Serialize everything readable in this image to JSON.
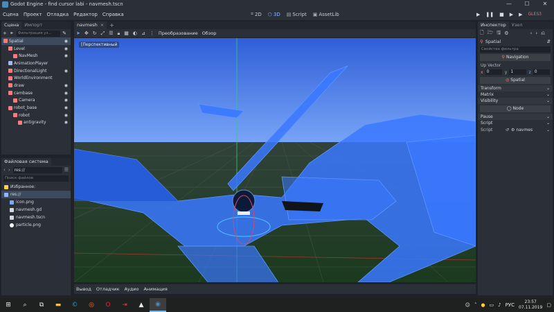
{
  "window": {
    "title": "Godot Engine - find cursor labi - navmesh.tscn",
    "controls": [
      "—",
      "☐",
      "✕"
    ]
  },
  "menu": {
    "items": [
      "Сцена",
      "Проект",
      "Отладка",
      "Редактор",
      "Справка"
    ]
  },
  "workspaces": {
    "items": [
      {
        "label": "2D",
        "icon": "grid-icon"
      },
      {
        "label": "3D",
        "icon": "cube-icon"
      },
      {
        "label": "Script",
        "icon": "script-icon"
      },
      {
        "label": "AssetLib",
        "icon": "assetlib-icon"
      }
    ],
    "active": "3D"
  },
  "playbar": {
    "buttons": [
      "▶",
      "❚❚",
      "■",
      "▶",
      "▶"
    ],
    "renderer": "GLES3"
  },
  "scene_dock": {
    "tabs": [
      "Сцена",
      "Импорт"
    ],
    "filter_placeholder": "Фильтрация уз...",
    "nodes": [
      {
        "label": "Spatial",
        "indent": 0,
        "color": "#ff7a7a",
        "eye": true,
        "selected": true
      },
      {
        "label": "Level",
        "indent": 1,
        "color": "#ff7a7a",
        "eye": true
      },
      {
        "label": "NavMesh",
        "indent": 2,
        "color": "#ff7a7a",
        "eye": true
      },
      {
        "label": "AnimationPlayer",
        "indent": 1,
        "color": "#a5b7f3",
        "eye": false
      },
      {
        "label": "DirectionalLight",
        "indent": 1,
        "color": "#ff7a7a",
        "eye": true
      },
      {
        "label": "WorldEnvironment",
        "indent": 1,
        "color": "#ff7a7a",
        "eye": false
      },
      {
        "label": "draw",
        "indent": 1,
        "color": "#ff7a7a",
        "eye": true
      },
      {
        "label": "cambase",
        "indent": 1,
        "color": "#ff7a7a",
        "eye": true
      },
      {
        "label": "Camera",
        "indent": 2,
        "color": "#ff7a7a",
        "eye": true
      },
      {
        "label": "robot_base",
        "indent": 1,
        "color": "#ff7a7a",
        "eye": true
      },
      {
        "label": "robot",
        "indent": 2,
        "color": "#ff7a7a",
        "eye": true
      },
      {
        "label": "antigravity",
        "indent": 3,
        "color": "#ff7a7a",
        "eye": true
      }
    ]
  },
  "filesystem": {
    "title": "Файловая система",
    "path": "res://",
    "search_placeholder": "Поиск файлов",
    "items": [
      {
        "label": "Избранное:",
        "icon": "star-icon",
        "indent": 0
      },
      {
        "label": "res://",
        "icon": "folder-icon",
        "indent": 0,
        "selected": true
      },
      {
        "label": "icon.png",
        "icon": "image-icon",
        "indent": 1
      },
      {
        "label": "navmesh.gd",
        "icon": "gear-icon",
        "indent": 1
      },
      {
        "label": "navmesh.tscn",
        "icon": "scene-icon",
        "indent": 1
      },
      {
        "label": "particle.png",
        "icon": "dot-icon",
        "indent": 1
      }
    ]
  },
  "viewport": {
    "tab": "navmesh",
    "toolbar_text": [
      "Преобразование",
      "Обзор"
    ],
    "perspective": "[Перспективный"
  },
  "bottom_panel": {
    "tabs": [
      "Вывод",
      "Отладчик",
      "Аудио",
      "Анимация"
    ]
  },
  "inspector": {
    "tabs": [
      "Инспектор",
      "Узел"
    ],
    "object": "Spatial",
    "filter_placeholder": "Свойства фильтра",
    "sections": {
      "navigation": "Navigation",
      "spatial": "Spatial",
      "node": "Node"
    },
    "up_vector_label": "Up Vector",
    "up_vector": {
      "x": "0",
      "y": "1",
      "z": "0"
    },
    "spatial_cats": [
      "Transform",
      "Matrix",
      "Visibility"
    ],
    "node_cats": [
      "Pause",
      "Script"
    ],
    "script_label": "Script",
    "script_value": "navmes"
  },
  "taskbar": {
    "lang": "РУС",
    "time": "23:57",
    "date": "07.11.2019"
  },
  "colors": {
    "accent": "#478cbf",
    "selection": "#3b4a5d",
    "sky": "#6fa6ff",
    "mesh": "#3a78ff"
  }
}
